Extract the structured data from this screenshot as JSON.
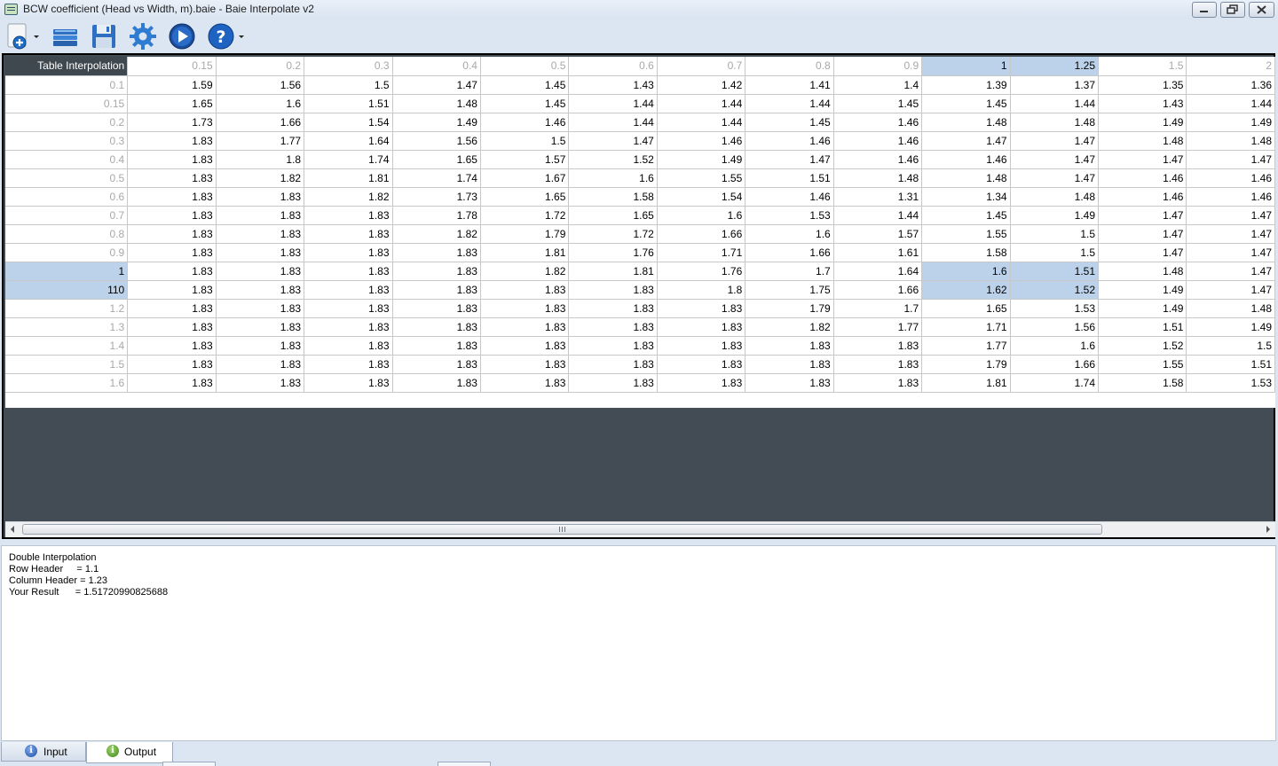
{
  "window": {
    "title": "BCW coefficient (Head vs Width, m).baie - Baie Interpolate v2",
    "controls": {
      "minimize": "minimize-icon",
      "maximize": "restore-icon",
      "close": "close-icon"
    }
  },
  "toolbar": {
    "buttons": [
      {
        "name": "new",
        "icon": "new-plus-icon",
        "has_dropdown": true
      },
      {
        "name": "open",
        "icon": "open-icon",
        "has_dropdown": false
      },
      {
        "name": "save",
        "icon": "save-icon",
        "has_dropdown": false
      },
      {
        "name": "settings",
        "icon": "gear-icon",
        "has_dropdown": false
      },
      {
        "name": "run",
        "icon": "play-icon",
        "has_dropdown": false
      },
      {
        "name": "help",
        "icon": "help-icon",
        "has_dropdown": true
      }
    ]
  },
  "grid": {
    "corner_label": "Table Interpolation",
    "columns": [
      "0.15",
      "0.2",
      "0.3",
      "0.4",
      "0.5",
      "0.6",
      "0.7",
      "0.8",
      "0.9",
      "1",
      "1.25",
      "1.5",
      "2"
    ],
    "selected_columns": [
      9,
      10
    ],
    "selected_rows": [
      10,
      11
    ],
    "rows": [
      {
        "header": "0.1",
        "values": [
          "1.59",
          "1.56",
          "1.5",
          "1.47",
          "1.45",
          "1.43",
          "1.42",
          "1.41",
          "1.4",
          "1.39",
          "1.37",
          "1.35",
          "1.36"
        ]
      },
      {
        "header": "0.15",
        "values": [
          "1.65",
          "1.6",
          "1.51",
          "1.48",
          "1.45",
          "1.44",
          "1.44",
          "1.44",
          "1.45",
          "1.45",
          "1.44",
          "1.43",
          "1.44"
        ]
      },
      {
        "header": "0.2",
        "values": [
          "1.73",
          "1.66",
          "1.54",
          "1.49",
          "1.46",
          "1.44",
          "1.44",
          "1.45",
          "1.46",
          "1.48",
          "1.48",
          "1.49",
          "1.49"
        ]
      },
      {
        "header": "0.3",
        "values": [
          "1.83",
          "1.77",
          "1.64",
          "1.56",
          "1.5",
          "1.47",
          "1.46",
          "1.46",
          "1.46",
          "1.47",
          "1.47",
          "1.48",
          "1.48"
        ]
      },
      {
        "header": "0.4",
        "values": [
          "1.83",
          "1.8",
          "1.74",
          "1.65",
          "1.57",
          "1.52",
          "1.49",
          "1.47",
          "1.46",
          "1.46",
          "1.47",
          "1.47",
          "1.47"
        ]
      },
      {
        "header": "0.5",
        "values": [
          "1.83",
          "1.82",
          "1.81",
          "1.74",
          "1.67",
          "1.6",
          "1.55",
          "1.51",
          "1.48",
          "1.48",
          "1.47",
          "1.46",
          "1.46"
        ]
      },
      {
        "header": "0.6",
        "values": [
          "1.83",
          "1.83",
          "1.82",
          "1.73",
          "1.65",
          "1.58",
          "1.54",
          "1.46",
          "1.31",
          "1.34",
          "1.48",
          "1.46",
          "1.46"
        ]
      },
      {
        "header": "0.7",
        "values": [
          "1.83",
          "1.83",
          "1.83",
          "1.78",
          "1.72",
          "1.65",
          "1.6",
          "1.53",
          "1.44",
          "1.45",
          "1.49",
          "1.47",
          "1.47"
        ]
      },
      {
        "header": "0.8",
        "values": [
          "1.83",
          "1.83",
          "1.83",
          "1.82",
          "1.79",
          "1.72",
          "1.66",
          "1.6",
          "1.57",
          "1.55",
          "1.5",
          "1.47",
          "1.47"
        ]
      },
      {
        "header": "0.9",
        "values": [
          "1.83",
          "1.83",
          "1.83",
          "1.83",
          "1.81",
          "1.76",
          "1.71",
          "1.66",
          "1.61",
          "1.58",
          "1.5",
          "1.47",
          "1.47"
        ]
      },
      {
        "header": "1",
        "values": [
          "1.83",
          "1.83",
          "1.83",
          "1.83",
          "1.82",
          "1.81",
          "1.76",
          "1.7",
          "1.64",
          "1.6",
          "1.51",
          "1.48",
          "1.47"
        ]
      },
      {
        "header": "110",
        "values": [
          "1.83",
          "1.83",
          "1.83",
          "1.83",
          "1.83",
          "1.83",
          "1.8",
          "1.75",
          "1.66",
          "1.62",
          "1.52",
          "1.49",
          "1.47"
        ]
      },
      {
        "header": "1.2",
        "values": [
          "1.83",
          "1.83",
          "1.83",
          "1.83",
          "1.83",
          "1.83",
          "1.83",
          "1.79",
          "1.7",
          "1.65",
          "1.53",
          "1.49",
          "1.48"
        ]
      },
      {
        "header": "1.3",
        "values": [
          "1.83",
          "1.83",
          "1.83",
          "1.83",
          "1.83",
          "1.83",
          "1.83",
          "1.82",
          "1.77",
          "1.71",
          "1.56",
          "1.51",
          "1.49"
        ]
      },
      {
        "header": "1.4",
        "values": [
          "1.83",
          "1.83",
          "1.83",
          "1.83",
          "1.83",
          "1.83",
          "1.83",
          "1.83",
          "1.83",
          "1.77",
          "1.6",
          "1.52",
          "1.5"
        ]
      },
      {
        "header": "1.5",
        "values": [
          "1.83",
          "1.83",
          "1.83",
          "1.83",
          "1.83",
          "1.83",
          "1.83",
          "1.83",
          "1.83",
          "1.79",
          "1.66",
          "1.55",
          "1.51"
        ]
      },
      {
        "header": "1.6",
        "values": [
          "1.83",
          "1.83",
          "1.83",
          "1.83",
          "1.83",
          "1.83",
          "1.83",
          "1.83",
          "1.83",
          "1.81",
          "1.74",
          "1.58",
          "1.53"
        ]
      }
    ]
  },
  "scrollbar": {
    "grip": "grip-icon"
  },
  "output": {
    "lines": [
      "Double Interpolation",
      "Row Header     = 1.1",
      "Column Header = 1.23",
      "Your Result      = 1.51720990825688"
    ]
  },
  "tabs": [
    {
      "label": "Input",
      "icon": "info-icon",
      "active": false
    },
    {
      "label": "Output",
      "icon": "info-icon",
      "active": true
    }
  ]
}
